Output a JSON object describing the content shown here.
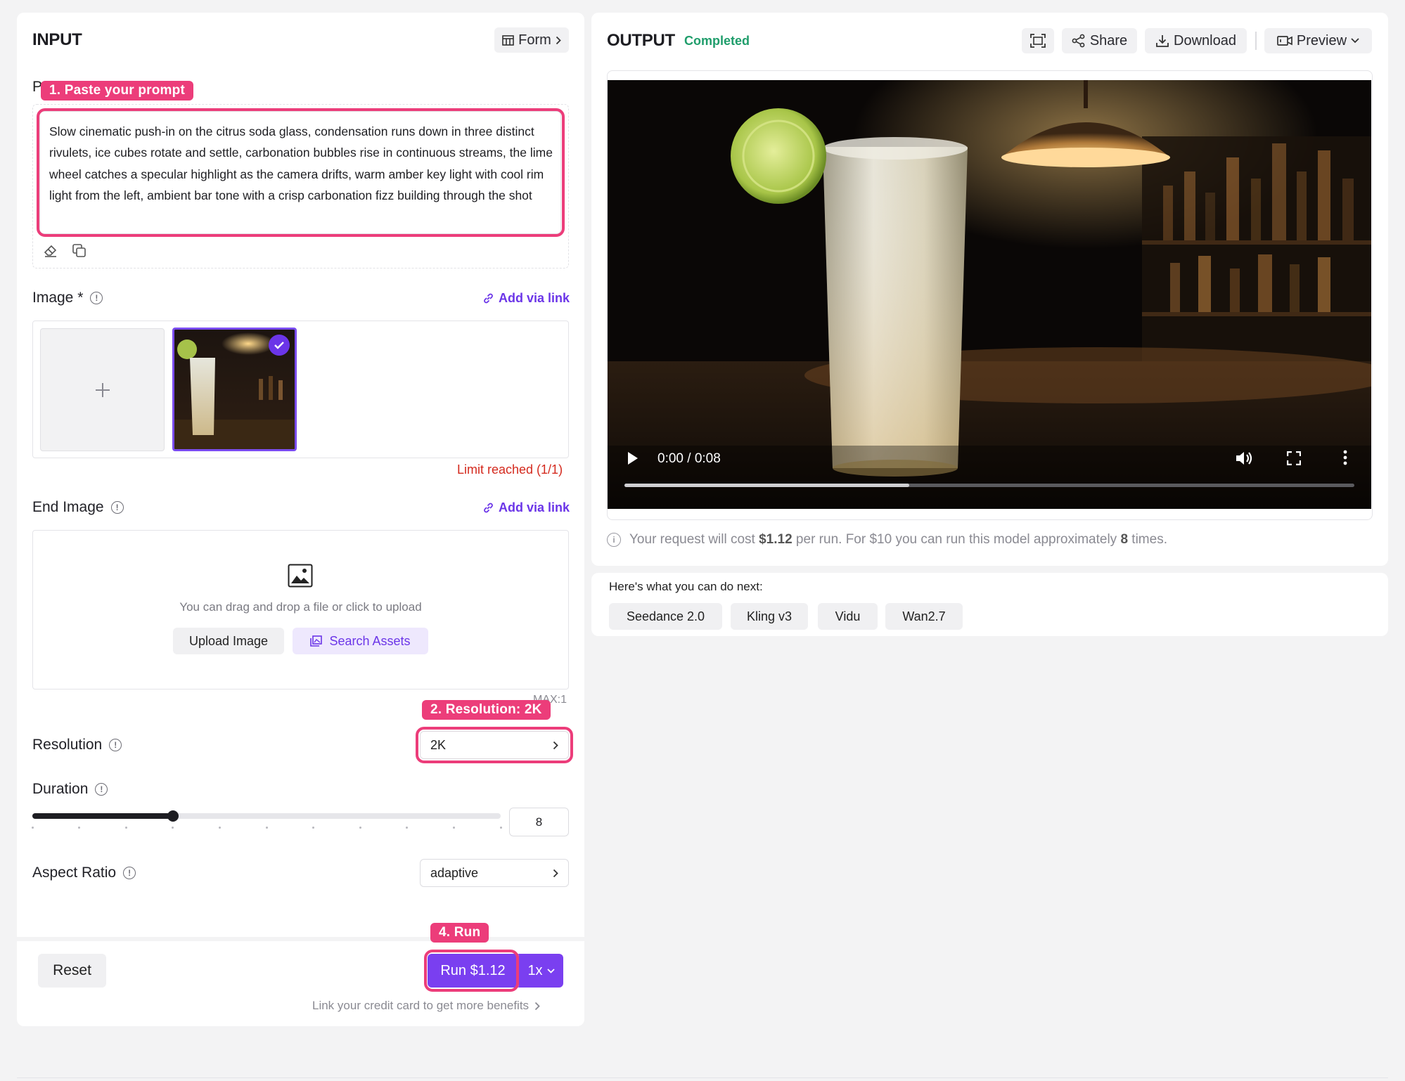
{
  "input": {
    "title": "INPUT",
    "form_button": "Form",
    "prompt_label_partial": "P",
    "prompt_text": "Slow cinematic push-in on the citrus soda glass, condensation runs down in three distinct rivulets, ice cubes rotate and settle, carbonation bubbles rise in continuous streams, the lime wheel catches a specular highlight as the camera drifts, warm amber key light with cool rim light from the left, ambient bar tone with a crisp carbonation fizz building through the shot",
    "image_label": "Image *",
    "add_via_link": "Add via link",
    "limit_reached": "Limit reached (1/1)",
    "end_image_label": "End Image",
    "end_image_add_via_link": "Add via link",
    "upload_hint": "You can drag and drop a file or click to upload",
    "upload_button": "Upload Image",
    "search_assets_button": "Search Assets",
    "max_note": "MAX:1",
    "resolution_label": "Resolution",
    "resolution_value": "2K",
    "duration_label": "Duration",
    "duration_value": "8",
    "duration_fraction": 0.3,
    "aspect_ratio_label": "Aspect Ratio",
    "aspect_ratio_value": "adaptive",
    "reset_button": "Reset",
    "run_button": "Run $1.12",
    "multiplier": "1x",
    "credit_link": "Link your credit card to get more benefits"
  },
  "annotations": {
    "step1": "1. Paste your prompt",
    "step2": "2. Resolution: 2K",
    "step4": "4. Run"
  },
  "output": {
    "title": "OUTPUT",
    "status": "Completed",
    "share_button": "Share",
    "download_button": "Download",
    "preview_button": "Preview",
    "video_time": "0:00 / 0:08",
    "video_progress_fraction": 0.39,
    "cost_prefix": "Your request will cost ",
    "cost_amount": "$1.12",
    "cost_middle": " per run. For $10 you can run this model approximately ",
    "cost_runs": "8",
    "cost_suffix": " times."
  },
  "next": {
    "heading": "Here's what you can do next:",
    "models": [
      "Seedance 2.0",
      "Kling v3",
      "Vidu",
      "Wan2.7"
    ]
  },
  "colors": {
    "accent": "#6b35e8",
    "annotation": "#ec3d7a",
    "status_green": "#1f9d6b",
    "error_red": "#d42a1e"
  }
}
